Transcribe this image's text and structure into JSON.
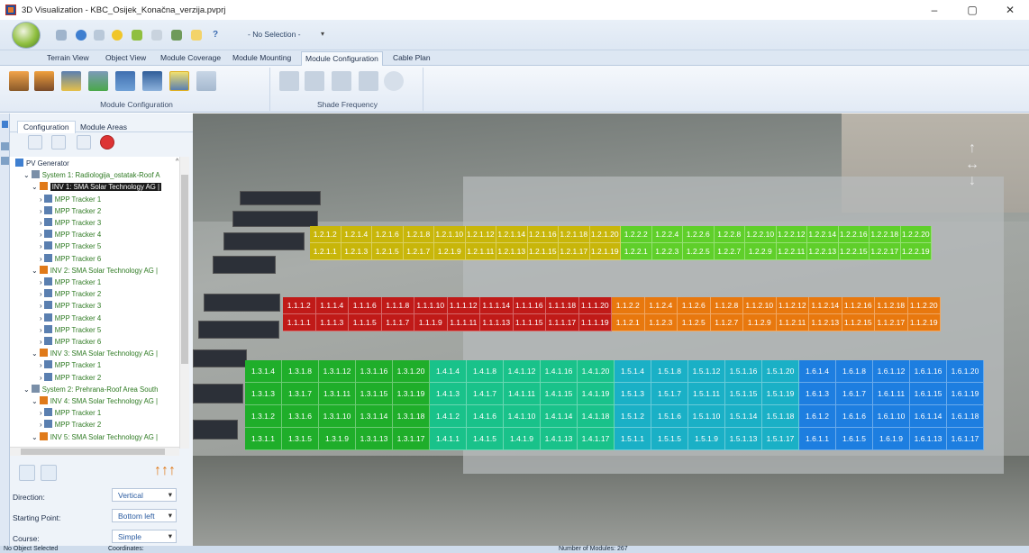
{
  "title": "3D Visualization - KBC_Osijek_Konačna_verzija.pvprj",
  "window_controls": [
    "–",
    "▢",
    "✕"
  ],
  "quick_access": {
    "selection": "- No Selection -",
    "help": "?"
  },
  "tabs": [
    {
      "label": "Terrain View",
      "active": false
    },
    {
      "label": "Object View",
      "active": false
    },
    {
      "label": "Module Coverage",
      "active": false
    },
    {
      "label": "Module Mounting",
      "active": false
    },
    {
      "label": "Module Configuration",
      "active": true
    },
    {
      "label": "Cable Plan",
      "active": false
    }
  ],
  "ribbon": {
    "group1": "Module Configuration",
    "group2": "Shade Frequency"
  },
  "panel": {
    "tabs": [
      "Configuration",
      "Module Areas"
    ],
    "tree": [
      {
        "label": "PV Generator",
        "indent": 0,
        "color": "#1f2f4a",
        "icon": "pv-generator-icon"
      },
      {
        "label": "System 1: Radiologija_ostatak-Roof A",
        "indent": 1,
        "color": "#2e7a22",
        "icon": "system-icon"
      },
      {
        "label": "INV 1: SMA Solar Technology AG |",
        "indent": 2,
        "color": "#2e7a22",
        "icon": "inverter-icon",
        "selected": true
      },
      {
        "label": "MPP Tracker 1",
        "indent": 3,
        "color": "#2e7a22",
        "icon": "mpp-icon"
      },
      {
        "label": "MPP Tracker 2",
        "indent": 3,
        "color": "#2e7a22",
        "icon": "mpp-icon"
      },
      {
        "label": "MPP Tracker 3",
        "indent": 3,
        "color": "#2e7a22",
        "icon": "mpp-icon"
      },
      {
        "label": "MPP Tracker 4",
        "indent": 3,
        "color": "#2e7a22",
        "icon": "mpp-icon"
      },
      {
        "label": "MPP Tracker 5",
        "indent": 3,
        "color": "#2e7a22",
        "icon": "mpp-icon"
      },
      {
        "label": "MPP Tracker 6",
        "indent": 3,
        "color": "#2e7a22",
        "icon": "mpp-icon"
      },
      {
        "label": "INV 2: SMA Solar Technology AG |",
        "indent": 2,
        "color": "#2e7a22",
        "icon": "inverter-icon"
      },
      {
        "label": "MPP Tracker 1",
        "indent": 3,
        "color": "#2e7a22",
        "icon": "mpp-icon"
      },
      {
        "label": "MPP Tracker 2",
        "indent": 3,
        "color": "#2e7a22",
        "icon": "mpp-icon"
      },
      {
        "label": "MPP Tracker 3",
        "indent": 3,
        "color": "#2e7a22",
        "icon": "mpp-icon"
      },
      {
        "label": "MPP Tracker 4",
        "indent": 3,
        "color": "#2e7a22",
        "icon": "mpp-icon"
      },
      {
        "label": "MPP Tracker 5",
        "indent": 3,
        "color": "#2e7a22",
        "icon": "mpp-icon"
      },
      {
        "label": "MPP Tracker 6",
        "indent": 3,
        "color": "#2e7a22",
        "icon": "mpp-icon"
      },
      {
        "label": "INV 3: SMA Solar Technology AG |",
        "indent": 2,
        "color": "#2e7a22",
        "icon": "inverter-icon"
      },
      {
        "label": "MPP Tracker 1",
        "indent": 3,
        "color": "#2e7a22",
        "icon": "mpp-icon"
      },
      {
        "label": "MPP Tracker 2",
        "indent": 3,
        "color": "#2e7a22",
        "icon": "mpp-icon"
      },
      {
        "label": "System 2: Prehrana-Roof Area South",
        "indent": 1,
        "color": "#2e7a22",
        "icon": "system-icon"
      },
      {
        "label": "INV 4: SMA Solar Technology AG |",
        "indent": 2,
        "color": "#2e7a22",
        "icon": "inverter-icon"
      },
      {
        "label": "MPP Tracker 1",
        "indent": 3,
        "color": "#2e7a22",
        "icon": "mpp-icon"
      },
      {
        "label": "MPP Tracker 2",
        "indent": 3,
        "color": "#2e7a22",
        "icon": "mpp-icon"
      },
      {
        "label": "INV 5: SMA Solar Technology AG |",
        "indent": 2,
        "color": "#2e7a22",
        "icon": "inverter-icon"
      }
    ],
    "direction_label": "Direction:",
    "direction_value": "Vertical",
    "start_label": "Starting Point:",
    "start_value": "Bottom left",
    "course_label": "Course:",
    "course_value": "Simple"
  },
  "arrays": [
    {
      "color": "#c8b60a",
      "rows": [
        [
          "1.2.1.2",
          "1.2.1.4",
          "1.2.1.6",
          "1.2.1.8",
          "1.2.1.10",
          "1.2.1.12",
          "1.2.1.14",
          "1.2.1.16",
          "1.2.1.18",
          "1.2.1.20",
          "1.2.2.2",
          "1.2.2.4",
          "1.2.2.6",
          "1.2.2.8",
          "1.2.2.10",
          "1.2.2.12",
          "1.2.2.14",
          "1.2.2.16",
          "1.2.2.18",
          "1.2.2.20"
        ],
        [
          "1.2.1.1",
          "1.2.1.3",
          "1.2.1.5",
          "1.2.1.7",
          "1.2.1.9",
          "1.2.1.11",
          "1.2.1.13",
          "1.2.1.15",
          "1.2.1.17",
          "1.2.1.19",
          "1.2.2.1",
          "1.2.2.3",
          "1.2.2.5",
          "1.2.2.7",
          "1.2.2.9",
          "1.2.2.11",
          "1.2.2.13",
          "1.2.2.15",
          "1.2.2.17",
          "1.2.2.19"
        ]
      ]
    },
    {
      "color": "#c01a18",
      "rows": [
        [
          "1.1.1.2",
          "1.1.1.4",
          "1.1.1.6",
          "1.1.1.8",
          "1.1.1.10",
          "1.1.1.12",
          "1.1.1.14",
          "1.1.1.16",
          "1.1.1.18",
          "1.1.1.20",
          "1.1.2.2",
          "1.1.2.4",
          "1.1.2.6",
          "1.1.2.8",
          "1.1.2.10",
          "1.1.2.12",
          "1.1.2.14",
          "1.1.2.16",
          "1.1.2.18",
          "1.1.2.20"
        ],
        [
          "1.1.1.1",
          "1.1.1.3",
          "1.1.1.5",
          "1.1.1.7",
          "1.1.1.9",
          "1.1.1.11",
          "1.1.1.13",
          "1.1.1.15",
          "1.1.1.17",
          "1.1.1.19",
          "1.1.2.1",
          "1.1.2.3",
          "1.1.2.5",
          "1.1.2.7",
          "1.1.2.9",
          "1.1.2.11",
          "1.1.2.13",
          "1.1.2.15",
          "1.1.2.17",
          "1.1.2.19"
        ]
      ]
    },
    {
      "color": "#1fae2a",
      "rows": [
        [
          "1.3.1.4",
          "1.3.1.8",
          "1.3.1.12",
          "1.3.1.16",
          "1.3.1.20",
          "1.4.1.4",
          "1.4.1.8",
          "1.4.1.12",
          "1.4.1.16",
          "1.4.1.20",
          "1.5.1.4",
          "1.5.1.8",
          "1.5.1.12",
          "1.5.1.16",
          "1.5.1.20",
          "1.6.1.4",
          "1.6.1.8",
          "1.6.1.12",
          "1.6.1.16",
          "1.6.1.20"
        ],
        [
          "1.3.1.3",
          "1.3.1.7",
          "1.3.1.11",
          "1.3.1.15",
          "1.3.1.19",
          "1.4.1.3",
          "1.4.1.7",
          "1.4.1.11",
          "1.4.1.15",
          "1.4.1.19",
          "1.5.1.3",
          "1.5.1.7",
          "1.5.1.11",
          "1.5.1.15",
          "1.5.1.19",
          "1.6.1.3",
          "1.6.1.7",
          "1.6.1.11",
          "1.6.1.15",
          "1.6.1.19"
        ],
        [
          "1.3.1.2",
          "1.3.1.6",
          "1.3.1.10",
          "1.3.1.14",
          "1.3.1.18",
          "1.4.1.2",
          "1.4.1.6",
          "1.4.1.10",
          "1.4.1.14",
          "1.4.1.18",
          "1.5.1.2",
          "1.5.1.6",
          "1.5.1.10",
          "1.5.1.14",
          "1.5.1.18",
          "1.6.1.2",
          "1.6.1.6",
          "1.6.1.10",
          "1.6.1.14",
          "1.6.1.18"
        ],
        [
          "1.3.1.1",
          "1.3.1.5",
          "1.3.1.9",
          "1.3.1.13",
          "1.3.1.17",
          "1.4.1.1",
          "1.4.1.5",
          "1.4.1.9",
          "1.4.1.13",
          "1.4.1.17",
          "1.5.1.1",
          "1.5.1.5",
          "1.5.1.9",
          "1.5.1.13",
          "1.5.1.17",
          "1.6.1.1",
          "1.6.1.5",
          "1.6.1.9",
          "1.6.1.13",
          "1.6.1.17"
        ]
      ]
    }
  ],
  "section_colors": {
    "yellow_a": "#c8b60a",
    "green_b": "#5fcf2a",
    "red": "#c01a18",
    "orange": "#e8780e",
    "green": "#1fae2a",
    "teal": "#19c28a",
    "cyan": "#1ab0c6",
    "blue": "#1d7ee0"
  },
  "status": {
    "left": "No Object Selected",
    "coords": "Coordinates:",
    "modules": "Number of Modules: 267"
  }
}
